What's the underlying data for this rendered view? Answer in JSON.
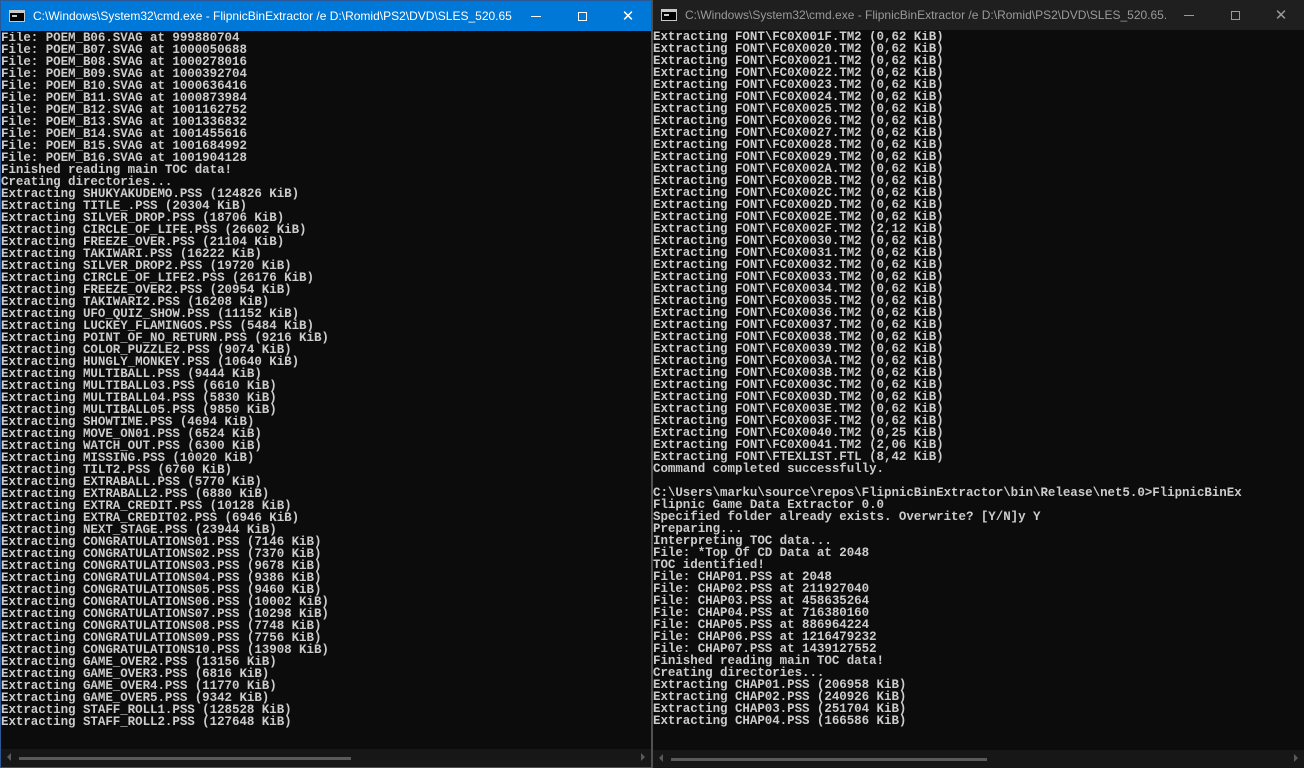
{
  "left_window": {
    "title": "C:\\Windows\\System32\\cmd.exe - FlipnicBinExtractor  /e D:\\Romid\\PS2\\DVD\\SLES_520.65....",
    "lines": [
      "File: POEM_B06.SVAG at 999880704",
      "File: POEM_B07.SVAG at 1000050688",
      "File: POEM_B08.SVAG at 1000278016",
      "File: POEM_B09.SVAG at 1000392704",
      "File: POEM_B10.SVAG at 1000636416",
      "File: POEM_B11.SVAG at 1000873984",
      "File: POEM_B12.SVAG at 1001162752",
      "File: POEM_B13.SVAG at 1001336832",
      "File: POEM_B14.SVAG at 1001455616",
      "File: POEM_B15.SVAG at 1001684992",
      "File: POEM_B16.SVAG at 1001904128",
      "Finished reading main TOC data!",
      "Creating directories...",
      "Extracting SHUKYAKUDEMO.PSS (124826 KiB)",
      "Extracting TITLE_.PSS (20304 KiB)",
      "Extracting SILVER_DROP.PSS (18706 KiB)",
      "Extracting CIRCLE_OF_LIFE.PSS (26602 KiB)",
      "Extracting FREEZE_OVER.PSS (21104 KiB)",
      "Extracting TAKIWARI.PSS (16222 KiB)",
      "Extracting SILVER_DROP2.PSS (19720 KiB)",
      "Extracting CIRCLE_OF_LIFE2.PSS (26176 KiB)",
      "Extracting FREEZE_OVER2.PSS (20954 KiB)",
      "Extracting TAKIWARI2.PSS (16208 KiB)",
      "Extracting UFO_QUIZ_SHOW.PSS (11152 KiB)",
      "Extracting LUCKEY_FLAMINGOS.PSS (5484 KiB)",
      "Extracting POINT_OF_NO_RETURN.PSS (9216 KiB)",
      "Extracting COLOR_PUZZLE2.PSS (9074 KiB)",
      "Extracting HUNGLY_MONKEY.PSS (10640 KiB)",
      "Extracting MULTIBALL.PSS (9444 KiB)",
      "Extracting MULTIBALL03.PSS (6610 KiB)",
      "Extracting MULTIBALL04.PSS (5830 KiB)",
      "Extracting MULTIBALL05.PSS (9850 KiB)",
      "Extracting SHOWTIME.PSS (4694 KiB)",
      "Extracting MOVE_ON01.PSS (6524 KiB)",
      "Extracting WATCH_OUT.PSS (6300 KiB)",
      "Extracting MISSING.PSS (10020 KiB)",
      "Extracting TILT2.PSS (6760 KiB)",
      "Extracting EXTRABALL.PSS (5770 KiB)",
      "Extracting EXTRABALL2.PSS (6880 KiB)",
      "Extracting EXTRA_CREDIT.PSS (10128 KiB)",
      "Extracting EXTRA_CREDIT02.PSS (6946 KiB)",
      "Extracting NEXT_STAGE.PSS (23944 KiB)",
      "Extracting CONGRATULATIONS01.PSS (7146 KiB)",
      "Extracting CONGRATULATIONS02.PSS (7370 KiB)",
      "Extracting CONGRATULATIONS03.PSS (9678 KiB)",
      "Extracting CONGRATULATIONS04.PSS (9386 KiB)",
      "Extracting CONGRATULATIONS05.PSS (9460 KiB)",
      "Extracting CONGRATULATIONS06.PSS (10002 KiB)",
      "Extracting CONGRATULATIONS07.PSS (10298 KiB)",
      "Extracting CONGRATULATIONS08.PSS (7748 KiB)",
      "Extracting CONGRATULATIONS09.PSS (7756 KiB)",
      "Extracting CONGRATULATIONS10.PSS (13908 KiB)",
      "Extracting GAME_OVER2.PSS (13156 KiB)",
      "Extracting GAME_OVER3.PSS (6816 KiB)",
      "Extracting GAME_OVER4.PSS (11770 KiB)",
      "Extracting GAME_OVER5.PSS (9342 KiB)",
      "Extracting STAFF_ROLL1.PSS (128528 KiB)",
      "Extracting STAFF_ROLL2.PSS (127648 KiB)"
    ]
  },
  "right_window": {
    "title": "C:\\Windows\\System32\\cmd.exe - FlipnicBinExtractor  /e D:\\Romid\\PS2\\DVD\\SLES_520.65....",
    "lines": [
      "Extracting FONT\\FC0X001F.TM2 (0,62 KiB)",
      "Extracting FONT\\FC0X0020.TM2 (0,62 KiB)",
      "Extracting FONT\\FC0X0021.TM2 (0,62 KiB)",
      "Extracting FONT\\FC0X0022.TM2 (0,62 KiB)",
      "Extracting FONT\\FC0X0023.TM2 (0,62 KiB)",
      "Extracting FONT\\FC0X0024.TM2 (0,62 KiB)",
      "Extracting FONT\\FC0X0025.TM2 (0,62 KiB)",
      "Extracting FONT\\FC0X0026.TM2 (0,62 KiB)",
      "Extracting FONT\\FC0X0027.TM2 (0,62 KiB)",
      "Extracting FONT\\FC0X0028.TM2 (0,62 KiB)",
      "Extracting FONT\\FC0X0029.TM2 (0,62 KiB)",
      "Extracting FONT\\FC0X002A.TM2 (0,62 KiB)",
      "Extracting FONT\\FC0X002B.TM2 (0,62 KiB)",
      "Extracting FONT\\FC0X002C.TM2 (0,62 KiB)",
      "Extracting FONT\\FC0X002D.TM2 (0,62 KiB)",
      "Extracting FONT\\FC0X002E.TM2 (0,62 KiB)",
      "Extracting FONT\\FC0X002F.TM2 (2,12 KiB)",
      "Extracting FONT\\FC0X0030.TM2 (0,62 KiB)",
      "Extracting FONT\\FC0X0031.TM2 (0,62 KiB)",
      "Extracting FONT\\FC0X0032.TM2 (0,62 KiB)",
      "Extracting FONT\\FC0X0033.TM2 (0,62 KiB)",
      "Extracting FONT\\FC0X0034.TM2 (0,62 KiB)",
      "Extracting FONT\\FC0X0035.TM2 (0,62 KiB)",
      "Extracting FONT\\FC0X0036.TM2 (0,62 KiB)",
      "Extracting FONT\\FC0X0037.TM2 (0,62 KiB)",
      "Extracting FONT\\FC0X0038.TM2 (0,62 KiB)",
      "Extracting FONT\\FC0X0039.TM2 (0,62 KiB)",
      "Extracting FONT\\FC0X003A.TM2 (0,62 KiB)",
      "Extracting FONT\\FC0X003B.TM2 (0,62 KiB)",
      "Extracting FONT\\FC0X003C.TM2 (0,62 KiB)",
      "Extracting FONT\\FC0X003D.TM2 (0,62 KiB)",
      "Extracting FONT\\FC0X003E.TM2 (0,62 KiB)",
      "Extracting FONT\\FC0X003F.TM2 (0,62 KiB)",
      "Extracting FONT\\FC0X0040.TM2 (0,25 KiB)",
      "Extracting FONT\\FC0X0041.TM2 (2,06 KiB)",
      "Extracting FONT\\FTEXLIST.FTL (8,42 KiB)",
      "Command completed successfully.",
      "",
      "C:\\Users\\marku\\source\\repos\\FlipnicBinExtractor\\bin\\Release\\net5.0>FlipnicBinEx",
      "Flipnic Game Data Extractor 0.0",
      "Specified folder already exists. Overwrite? [Y/N]y Y",
      "Preparing...",
      "Interpreting TOC data...",
      "File: *Top Of CD Data at 2048",
      "TOC identified!",
      "File: CHAP01.PSS at 2048",
      "File: CHAP02.PSS at 211927040",
      "File: CHAP03.PSS at 458635264",
      "File: CHAP04.PSS at 716380160",
      "File: CHAP05.PSS at 886964224",
      "File: CHAP06.PSS at 1216479232",
      "File: CHAP07.PSS at 1439127552",
      "Finished reading main TOC data!",
      "Creating directories...",
      "Extracting CHAP01.PSS (206958 KiB)",
      "Extracting CHAP02.PSS (240926 KiB)",
      "Extracting CHAP03.PSS (251704 KiB)",
      "Extracting CHAP04.PSS (166586 KiB)"
    ]
  },
  "icons": {
    "app": "console-icon",
    "minimize": "minimize-icon",
    "maximize": "maximize-icon",
    "close": "close-icon"
  },
  "colors": {
    "active_titlebar": "#0078d7",
    "inactive_titlebar": "#1f1f1f",
    "console_bg": "#0c0c0c",
    "console_text": "#cccccc"
  }
}
